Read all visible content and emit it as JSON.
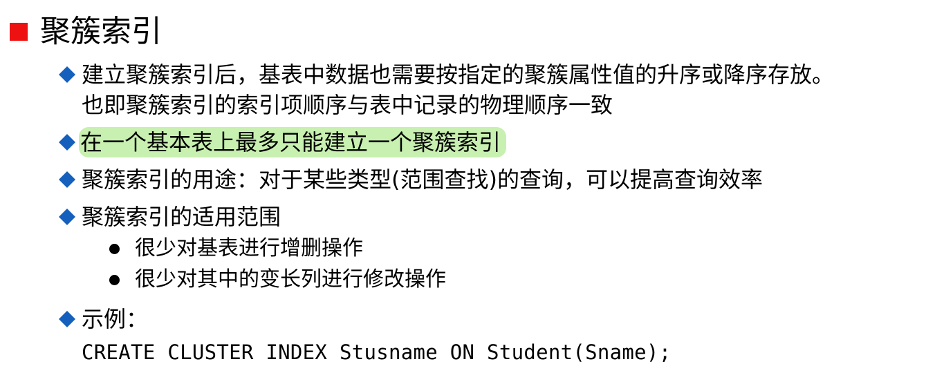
{
  "colors": {
    "title_square": "#ee1111",
    "bullet_diamond": "#1560bd",
    "highlight": "#c8f0b0",
    "text": "#000000"
  },
  "icons": {
    "title_marker": "red-square-icon",
    "bullet": "blue-diamond-icon",
    "sub_bullet": "black-dot-icon"
  },
  "title": "聚簇索引",
  "points": [
    {
      "lines": [
        "建立聚簇索引后，基表中数据也需要按指定的聚簇属性值的升序或降序存放。",
        "也即聚簇索引的索引项顺序与表中记录的物理顺序一致"
      ]
    },
    {
      "text": "在一个基本表上最多只能建立一个聚簇索引",
      "highlighted": true
    },
    {
      "text": "聚簇索引的用途：对于某些类型(范围查找)的查询，可以提高查询效率"
    },
    {
      "text": "聚簇索引的适用范围",
      "sub_items": [
        "很少对基表进行增删操作",
        "很少对其中的变长列进行修改操作"
      ]
    },
    {
      "text": "示例：",
      "code": "CREATE CLUSTER INDEX Stusname ON Student(Sname);"
    }
  ]
}
